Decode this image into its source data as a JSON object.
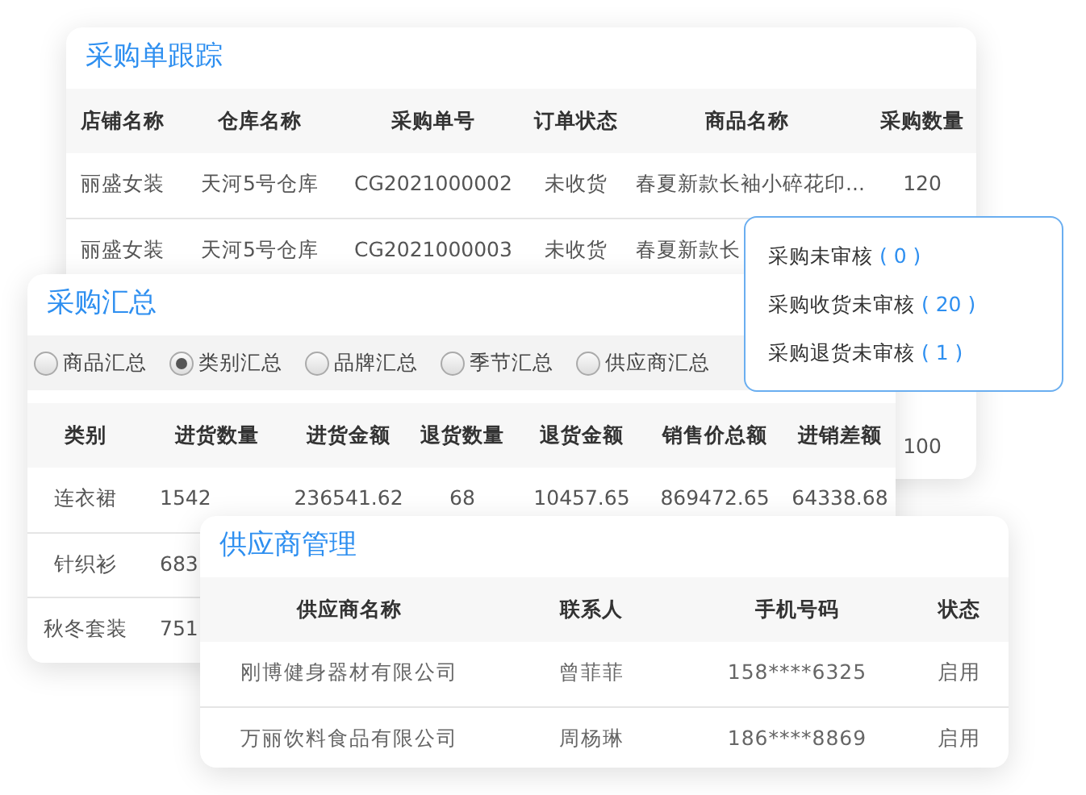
{
  "purchase_tracking": {
    "title": "采购单跟踪",
    "columns": [
      "店铺名称",
      "仓库名称",
      "采购单号",
      "订单状态",
      "商品名称",
      "采购数量"
    ],
    "rows": [
      [
        "丽盛女装",
        "天河5号仓库",
        "CG2021000002",
        "未收货",
        "春夏新款长袖小碎花印...",
        "120"
      ],
      [
        "丽盛女装",
        "天河5号仓库",
        "CG2021000003",
        "未收货",
        "春夏新款长",
        null
      ],
      [
        null,
        null,
        null,
        null,
        null,
        "100"
      ]
    ]
  },
  "pending_popup": {
    "items": [
      {
        "label": "采购未审核",
        "count": "( 0 )"
      },
      {
        "label": "采购收货未审核",
        "count": "( 20 )"
      },
      {
        "label": "采购退货未审核",
        "count": "( 1 )"
      }
    ]
  },
  "purchase_summary": {
    "title": "采购汇总",
    "options": [
      {
        "label": "商品汇总",
        "selected": false
      },
      {
        "label": "类别汇总",
        "selected": true
      },
      {
        "label": "品牌汇总",
        "selected": false
      },
      {
        "label": "季节汇总",
        "selected": false
      },
      {
        "label": "供应商汇总",
        "selected": false
      }
    ],
    "columns": [
      "类别",
      "进货数量",
      "进货金额",
      "退货数量",
      "退货金额",
      "销售价总额",
      "进销差额"
    ],
    "rows": [
      [
        "连衣裙",
        "1542",
        "236541.62",
        "68",
        "10457.65",
        "869472.65",
        "64338.68"
      ],
      [
        "针织衫",
        "683",
        null,
        null,
        null,
        null,
        null
      ],
      [
        "秋冬套装",
        "751",
        null,
        null,
        null,
        null,
        null
      ]
    ]
  },
  "supplier_management": {
    "title": "供应商管理",
    "columns": [
      "供应商名称",
      "联系人",
      "手机号码",
      "状态"
    ],
    "rows": [
      [
        "刚博健身器材有限公司",
        "曾菲菲",
        "158****6325",
        "启用"
      ],
      [
        "万丽饮料食品有限公司",
        "周杨琳",
        "186****8869",
        "启用"
      ]
    ]
  }
}
